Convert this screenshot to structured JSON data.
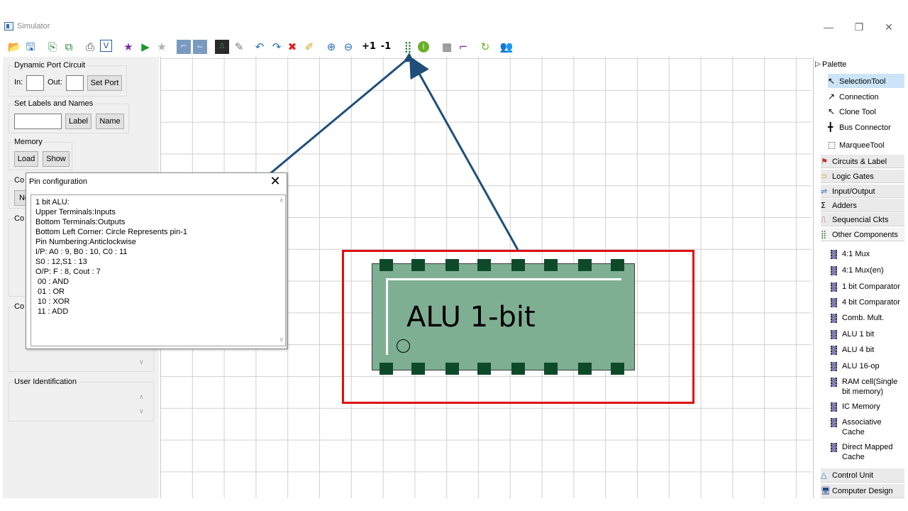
{
  "window": {
    "title": "Simulator",
    "minimize": "—",
    "restore": "❐",
    "close": "✕"
  },
  "toolbar": {
    "icons": [
      "open-folder-icon",
      "save-icon",
      "export-icon",
      "save-as-icon",
      "print-icon",
      "verify-icon",
      "star-icon",
      "play-icon",
      "grey-star-icon",
      "timing-icon",
      "timing2-icon",
      "waveform-icon",
      "edit-icon",
      "undo-icon",
      "redo-icon",
      "delete-icon",
      "eraser-icon",
      "zoom-in-icon",
      "zoom-out-icon"
    ],
    "plus_one": "+1",
    "minus_one": "-1"
  },
  "left_panel": {
    "dynamic_port": {
      "title": "Dynamic Port Circuit",
      "in_label": "In:",
      "out_label": "Out:",
      "set_port": "Set Port"
    },
    "labels_names": {
      "title": "Set Labels and Names",
      "label_btn": "Label",
      "name_btn": "Name"
    },
    "memory": {
      "title": "Memory",
      "load": "Load",
      "show": "Show"
    },
    "partial_co1": "Co",
    "partial_n": "Ne",
    "partial_co2": "Co",
    "partial_co3": "Co",
    "user_identification": "User Identification"
  },
  "dialog": {
    "title": "Pin configuration",
    "close": "✕",
    "lines": [
      "1 bit ALU:",
      "Upper Terminals:Inputs",
      "Bottom Terminals:Outputs",
      "Bottom Left Corner: Circle Represents pin-1",
      "Pin Numbering:Anticlockwise",
      "I/P: A0 : 9, B0 : 10, C0 : 11",
      "S0 : 12,S1 : 13",
      "O/P: F : 8, Cout : 7",
      " 00 : AND",
      " 01 : OR",
      " 10 : XOR",
      " 11 : ADD"
    ]
  },
  "chip": {
    "label": "ALU 1-bit"
  },
  "palette": {
    "header": "Palette",
    "tools": [
      "SelectionTool",
      "Connection",
      "Clone Tool",
      "Bus Connector",
      "MarqueeTool"
    ],
    "drawers": [
      "Circuits & Label",
      "Logic Gates",
      "Input/Output",
      "Adders",
      "Sequencial Ckts",
      "Other Components"
    ],
    "items": [
      "4:1 Mux",
      "4:1 Mux(en)",
      "1 bit Comparator",
      "4 bit Comparator",
      "Comb. Mult.",
      "ALU 1 bit",
      "ALU 4 bit",
      "ALU 16-op",
      "RAM cell(Single bit memory)",
      "IC Memory",
      "Associative Cache",
      "Direct Mapped Cache"
    ],
    "bottom_drawers": [
      "Control Unit",
      "Computer Design"
    ]
  },
  "colors": {
    "highlight_box": "#e01010",
    "arrow": "#1f4e79",
    "chip_body": "#7faf93",
    "chip_pin": "#0e4a2a"
  }
}
